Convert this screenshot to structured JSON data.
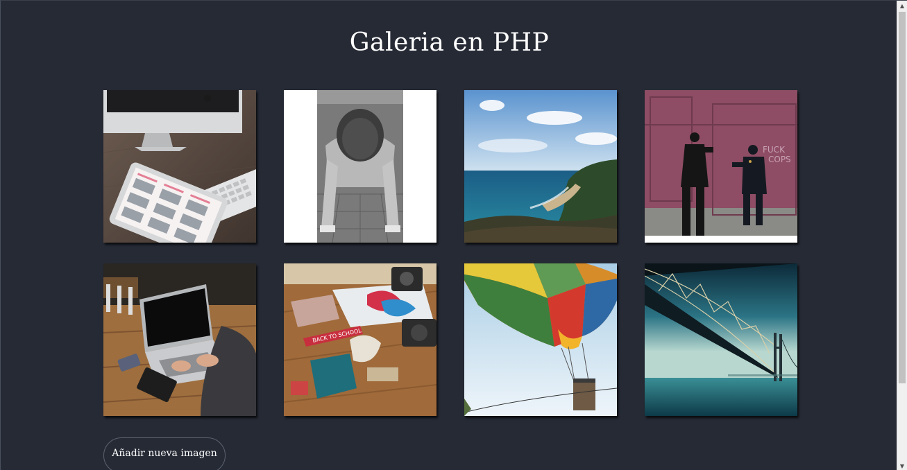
{
  "page": {
    "title": "Galeria en PHP"
  },
  "gallery": {
    "images": [
      {
        "name": "desk-imac-ipad-image"
      },
      {
        "name": "man-pushup-image"
      },
      {
        "name": "coast-beach-image"
      },
      {
        "name": "police-officers-image"
      },
      {
        "name": "laptop-typing-image"
      },
      {
        "name": "desk-flatlay-image"
      },
      {
        "name": "hot-air-balloon-image"
      },
      {
        "name": "suspension-bridge-image"
      }
    ]
  },
  "actions": {
    "add_image_label": "Añadir nueva imagen"
  },
  "colors": {
    "background": "#262a35",
    "title_text": "#ffffff",
    "button_border": "#5d6370"
  }
}
